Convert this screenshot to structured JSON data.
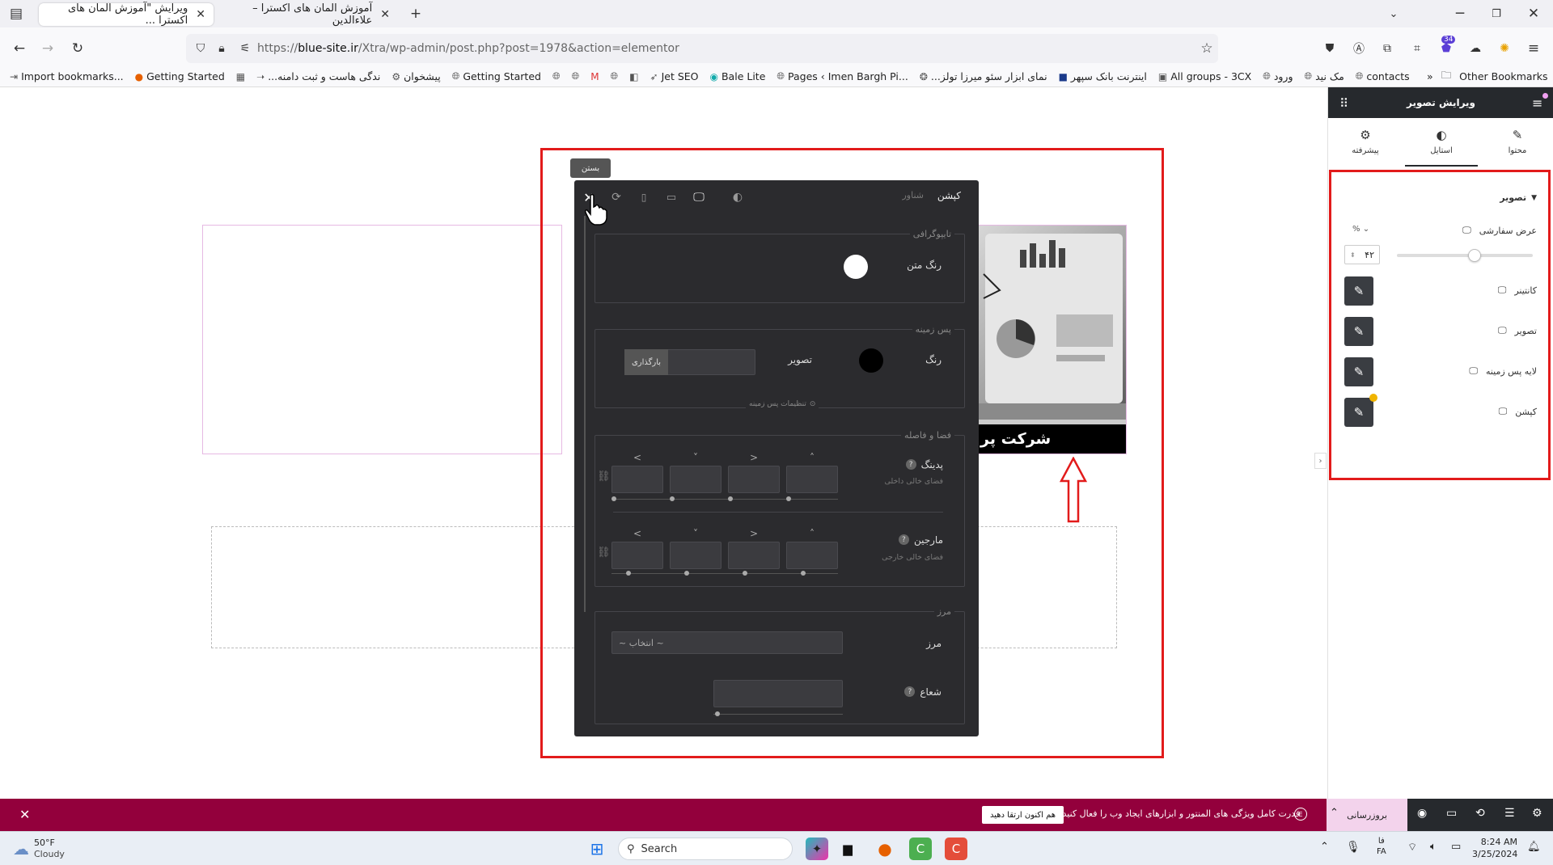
{
  "browser": {
    "tabs": [
      {
        "title": "ویرایش \"آموزش المان های اکسترا ..."
      },
      {
        "title": "آموزش المان های اکسترا – علاءالدین"
      }
    ],
    "url": {
      "prefix": "https://",
      "domain": "blue-site.ir",
      "path": "/Xtra/wp-admin/post.php?post=1978&action=elementor"
    },
    "extension_badge": "34",
    "bookmarks": [
      "Import bookmarks...",
      "Getting Started",
      "...ندگی هاست و ثبت دامنه",
      "پیشخوان",
      "Getting Started",
      "Jet SEO",
      "Bale Lite",
      "Pages ‹ Imen Bargh Pi...",
      "...نمای ابزار سئو میرزا تولز",
      "اینترنت بانک سپهر",
      "All groups - 3CX",
      "ورود",
      "مک نید",
      "contacts"
    ],
    "other_bookmarks": "Other Bookmarks"
  },
  "canvas": {
    "caption_text": "شرکت پر"
  },
  "popover": {
    "tooltip": "بستن",
    "tabs": {
      "active": "کپشن",
      "inactive": "شناور"
    },
    "typography": {
      "title": "تایپوگرافی",
      "text_color_label": "رنگ متن"
    },
    "background": {
      "title": "پس زمینه",
      "color_label": "رنگ",
      "image_label": "تصویر",
      "upload_button": "بارگذاری",
      "settings_link": "تنظیمات پس زمینه"
    },
    "spacing": {
      "title": "فضا و فاصله",
      "padding_label": "پدینگ",
      "padding_sub": "فضای خالی داخلی",
      "margin_label": "مارجین",
      "margin_sub": "فضای خالی خارجی",
      "arrows": [
        "<",
        "˅",
        ">",
        "˄"
      ]
    },
    "border": {
      "title": "مرز",
      "border_label": "مرز",
      "select_value": "~ انتخاب ~",
      "radius_label": "شعاع"
    }
  },
  "sidebar": {
    "title": "ویرایش تصویر",
    "tabs": [
      {
        "label": "محتوا"
      },
      {
        "label": "استایل"
      },
      {
        "label": "پیشرفته"
      }
    ],
    "section_title": "تصویر",
    "custom_width": {
      "label": "عرض سفارشی",
      "unit": "%",
      "value": "۴۲",
      "level": 0.42
    },
    "rows": [
      {
        "label": "کانتینر"
      },
      {
        "label": "تصویر"
      },
      {
        "label": "لایه پس زمینه"
      },
      {
        "label": "کپشن"
      }
    ]
  },
  "notice": {
    "text": "قدرت کامل ویژگی های المنتور و ابزارهای ایجاد وب را فعال کنید.",
    "upgrade_button": "هم اکنون ارتقا دهید"
  },
  "bottom_toolbar": {
    "update_button": "بروزرسانی"
  },
  "taskbar": {
    "weather_temp": "50°F",
    "weather_desc": "Cloudy",
    "search_placeholder": "Search",
    "lang_top": "فا",
    "lang_bottom": "FA",
    "time": "8:24 AM",
    "date": "3/25/2024"
  },
  "colors": {
    "accent": "#e21b1b",
    "notice_bg": "#93003c",
    "panel_bg": "#2b2b2e",
    "editor_dark": "#26292d"
  }
}
